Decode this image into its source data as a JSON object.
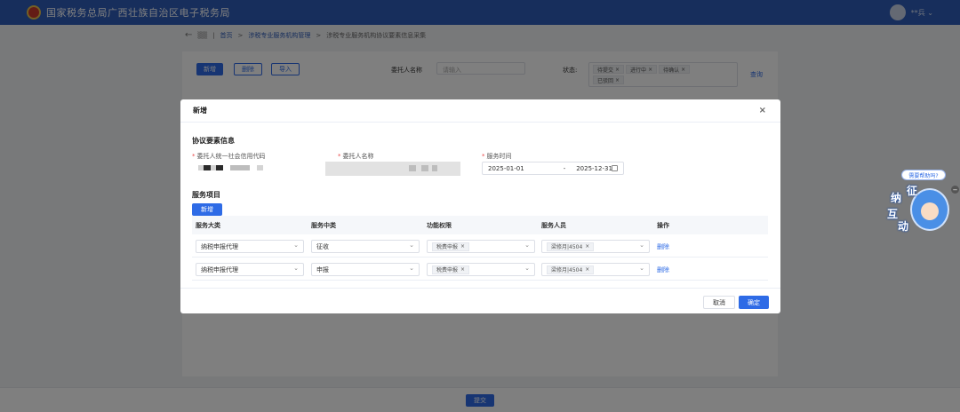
{
  "header": {
    "title": "国家税务总局广西壮族自治区电子税务局",
    "user_name": "**兵 ⌄"
  },
  "breadcrumb": {
    "back": "←",
    "items": [
      "首页",
      "涉税专业服务机构管理",
      "涉税专业服务机构协议要素信息采集"
    ]
  },
  "toolbar": {
    "add": "新增",
    "delete": "删除",
    "import": "导入"
  },
  "filters": {
    "client_label": "委托人名称",
    "client_placeholder": "请输入",
    "status_label": "状态:",
    "status_tags": [
      "待提交",
      "进行中",
      "待确认",
      "已驳回"
    ],
    "query": "查询"
  },
  "footer": {
    "submit": "提交"
  },
  "modal": {
    "title": "新增",
    "close": "×",
    "section_agreement": "协议要素信息",
    "field_credit_code": "委托人统一社会信用代码",
    "field_client_name": "委托人名称",
    "field_service_time": "服务时间",
    "date_start": "2025-01-01",
    "date_sep": "-",
    "date_end": "2025-12-31",
    "section_items": "服务项目",
    "add_item": "新增",
    "columns": [
      "服务大类",
      "服务中类",
      "功能权限",
      "服务人员",
      "操作"
    ],
    "rows": [
      {
        "category": "纳税申报代理",
        "subcategory": "征收",
        "permission": "税费申报",
        "staff": "梁修月|4504",
        "action": "删除"
      },
      {
        "category": "纳税申报代理",
        "subcategory": "申报",
        "permission": "税费申报",
        "staff": "梁修月|4504",
        "action": "删除"
      }
    ],
    "cancel": "取消",
    "confirm": "确定"
  },
  "helper": {
    "bubble": "需要帮助吗?",
    "chars": [
      "纳",
      "征",
      "互",
      "动"
    ],
    "minimize": "−"
  }
}
